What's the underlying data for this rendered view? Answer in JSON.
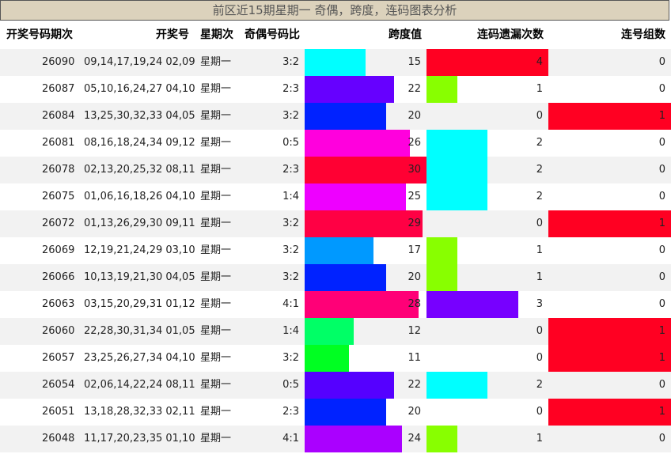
{
  "title": "前区近15期星期一 奇偶，跨度，连码图表分析",
  "headers": {
    "period": "开奖号码期次",
    "numbers": "开奖号",
    "weekday": "星期次",
    "odd_even": "奇偶号码比",
    "span": "跨度值",
    "consec_miss": "连码遗漏次数",
    "consec_groups": "连号组数"
  },
  "colors": {
    "row_alt": "#f2f2f2",
    "title_bg": "#dcd2bc",
    "span_bars": [
      "#00ffff",
      "#6600ff",
      "#0022ff",
      "#ff00dd",
      "#ff0033",
      "#ee00ff",
      "#ff0044",
      "#0099ff",
      "#0022ff",
      "#ff0077",
      "#00ff66",
      "#00ff22",
      "#5500ff",
      "#0022ff",
      "#aa00ff"
    ],
    "miss_colors": {
      "1": "#88ff00",
      "2": "#00ffff",
      "3": "#7700ff",
      "4": "#ff0022"
    },
    "group_color": "#ff0022"
  },
  "chart_data": {
    "type": "table",
    "columns": [
      "开奖号码期次",
      "开奖号",
      "星期次",
      "奇偶号码比",
      "跨度值",
      "连码遗漏次数",
      "连号组数"
    ],
    "span_max": 30,
    "miss_max": 4,
    "rows": [
      {
        "period": "26090",
        "numbers": "09,14,17,19,24 02,09",
        "weekday": "星期一",
        "ratio": "3:2",
        "span": 15,
        "miss": 4,
        "groups": 0
      },
      {
        "period": "26087",
        "numbers": "05,10,16,24,27 04,10",
        "weekday": "星期一",
        "ratio": "2:3",
        "span": 22,
        "miss": 1,
        "groups": 0
      },
      {
        "period": "26084",
        "numbers": "13,25,30,32,33 04,05",
        "weekday": "星期一",
        "ratio": "3:2",
        "span": 20,
        "miss": 0,
        "groups": 1
      },
      {
        "period": "26081",
        "numbers": "08,16,18,24,34 09,12",
        "weekday": "星期一",
        "ratio": "0:5",
        "span": 26,
        "miss": 2,
        "groups": 0
      },
      {
        "period": "26078",
        "numbers": "02,13,20,25,32 08,11",
        "weekday": "星期一",
        "ratio": "2:3",
        "span": 30,
        "miss": 2,
        "groups": 0
      },
      {
        "period": "26075",
        "numbers": "01,06,16,18,26 04,10",
        "weekday": "星期一",
        "ratio": "1:4",
        "span": 25,
        "miss": 2,
        "groups": 0
      },
      {
        "period": "26072",
        "numbers": "01,13,26,29,30 09,11",
        "weekday": "星期一",
        "ratio": "3:2",
        "span": 29,
        "miss": 0,
        "groups": 1
      },
      {
        "period": "26069",
        "numbers": "12,19,21,24,29 03,10",
        "weekday": "星期一",
        "ratio": "3:2",
        "span": 17,
        "miss": 1,
        "groups": 0
      },
      {
        "period": "26066",
        "numbers": "10,13,19,21,30 04,05",
        "weekday": "星期一",
        "ratio": "3:2",
        "span": 20,
        "miss": 1,
        "groups": 0
      },
      {
        "period": "26063",
        "numbers": "03,15,20,29,31 01,12",
        "weekday": "星期一",
        "ratio": "4:1",
        "span": 28,
        "miss": 3,
        "groups": 0
      },
      {
        "period": "26060",
        "numbers": "22,28,30,31,34 01,05",
        "weekday": "星期一",
        "ratio": "1:4",
        "span": 12,
        "miss": 0,
        "groups": 1
      },
      {
        "period": "26057",
        "numbers": "23,25,26,27,34 04,10",
        "weekday": "星期一",
        "ratio": "3:2",
        "span": 11,
        "miss": 0,
        "groups": 1
      },
      {
        "period": "26054",
        "numbers": "02,06,14,22,24 08,11",
        "weekday": "星期一",
        "ratio": "0:5",
        "span": 22,
        "miss": 2,
        "groups": 0
      },
      {
        "period": "26051",
        "numbers": "13,18,28,32,33 02,11",
        "weekday": "星期一",
        "ratio": "2:3",
        "span": 20,
        "miss": 0,
        "groups": 1
      },
      {
        "period": "26048",
        "numbers": "11,17,20,23,35 01,10",
        "weekday": "星期一",
        "ratio": "4:1",
        "span": 24,
        "miss": 1,
        "groups": 0
      }
    ]
  }
}
